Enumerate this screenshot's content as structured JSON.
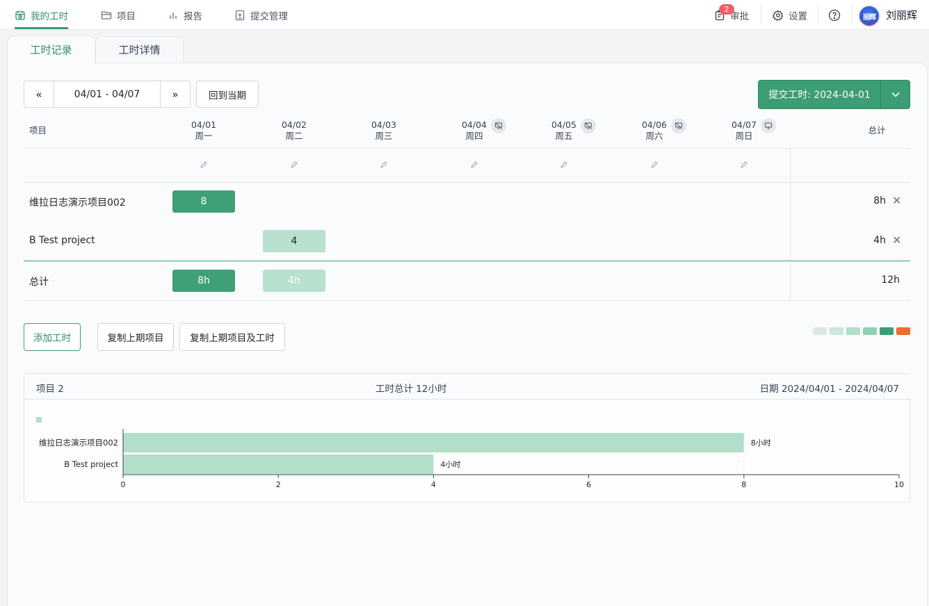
{
  "nav": {
    "items": [
      {
        "label": "我的工时",
        "icon": "clock-calendar-icon"
      },
      {
        "label": "项目",
        "icon": "folder-icon"
      },
      {
        "label": "报告",
        "icon": "bar-chart-icon"
      },
      {
        "label": "提交管理",
        "icon": "document-plus-icon"
      }
    ],
    "approve": {
      "label": "审批",
      "badge": "2",
      "icon": "clipboard-icon"
    },
    "settings": {
      "label": "设置",
      "icon": "gear-icon"
    },
    "help_icon": "question-icon",
    "avatar_text": "丽辉",
    "user_name": "刘丽辉"
  },
  "tabs": [
    {
      "label": "工时记录",
      "active": true
    },
    {
      "label": "工时详情",
      "active": false
    }
  ],
  "toolbar": {
    "prev": "«",
    "range": "04/01 - 04/07",
    "next": "»",
    "current": "回到当期",
    "submit": "提交工时: 2024-04-01"
  },
  "grid": {
    "project_header": "项目",
    "total_header": "总计",
    "days": [
      {
        "date": "04/01",
        "weekday": "周一",
        "icon": null
      },
      {
        "date": "04/02",
        "weekday": "周二",
        "icon": null
      },
      {
        "date": "04/03",
        "weekday": "周三",
        "icon": null
      },
      {
        "date": "04/04",
        "weekday": "周四",
        "icon": "monitor-off-icon"
      },
      {
        "date": "04/05",
        "weekday": "周五",
        "icon": "monitor-off-icon"
      },
      {
        "date": "04/06",
        "weekday": "周六",
        "icon": "monitor-off-icon"
      },
      {
        "date": "04/07",
        "weekday": "周日",
        "icon": "monitor-icon"
      }
    ],
    "rows": [
      {
        "project": "维拉日志演示项目002",
        "hours": [
          "8",
          "",
          "",
          "",
          "",
          "",
          ""
        ],
        "total": "8h"
      },
      {
        "project": "B Test project",
        "hours": [
          "",
          "4",
          "",
          "",
          "",
          "",
          ""
        ],
        "total": "4h"
      }
    ],
    "total_row": {
      "label": "总计",
      "hours": [
        "8h",
        "4h",
        "",
        "",
        "",
        "",
        ""
      ],
      "total": "12h"
    }
  },
  "actions": {
    "add": "添加工时",
    "copy_projects": "复制上期项目",
    "copy_projects_hours": "复制上期项目及工时"
  },
  "legend_colors": [
    "#dbe8e3",
    "#cbe6da",
    "#b3dec9",
    "#8fd0b0",
    "#3d9d74",
    "#f26b2e"
  ],
  "summary": {
    "projects": "项目 2",
    "total": "工时总计 12小时",
    "date": "日期 2024/04/01 - 2024/04/07"
  },
  "chart_data": {
    "type": "bar",
    "orientation": "horizontal",
    "categories": [
      "维拉日志演示项目002",
      "B Test project"
    ],
    "values": [
      8,
      4
    ],
    "value_labels": [
      "8小时",
      "4小时"
    ],
    "xlim": [
      0,
      10
    ],
    "x_ticks": [
      "0",
      "2",
      "4",
      "6",
      "8",
      "10"
    ],
    "color": "#b3dec9"
  }
}
